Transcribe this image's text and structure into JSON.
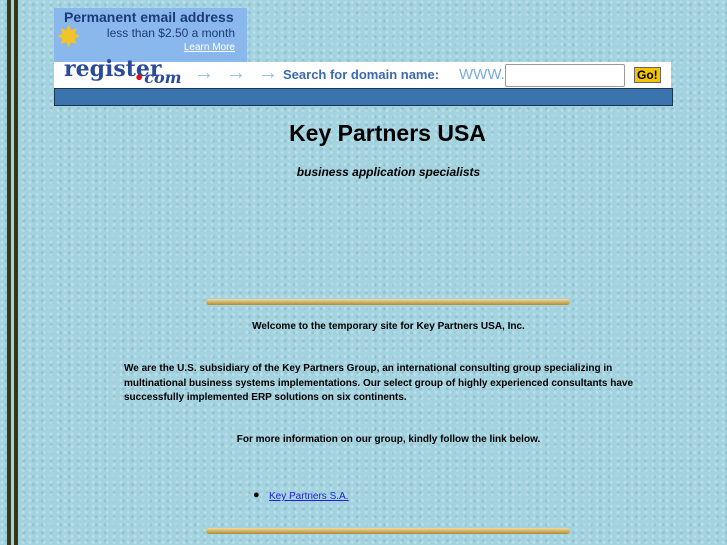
{
  "ad": {
    "headline": "Permanent email address",
    "price": "less than $2.50 a month",
    "learn_more": "Learn More",
    "logo": "register",
    "logo_suffix": "com",
    "search_label": "Search for domain name:",
    "www": "WWW.",
    "go": "Go!",
    "domain_value": ""
  },
  "page": {
    "title": "Key Partners USA",
    "subtitle": "business application specialists",
    "welcome": "Welcome to the temporary site for Key Partners USA, Inc.",
    "intro": "We are the U.S. subsidiary of the Key Partners Group, an international consulting group specializing in multinational business systems implementations. Our select group of highly experienced consultants have successfully implemented ERP solutions on six continents.",
    "more_info": "For more information on our group, kindly follow the link below.",
    "links": [
      {
        "label": "Key Partners S.A."
      }
    ]
  }
}
